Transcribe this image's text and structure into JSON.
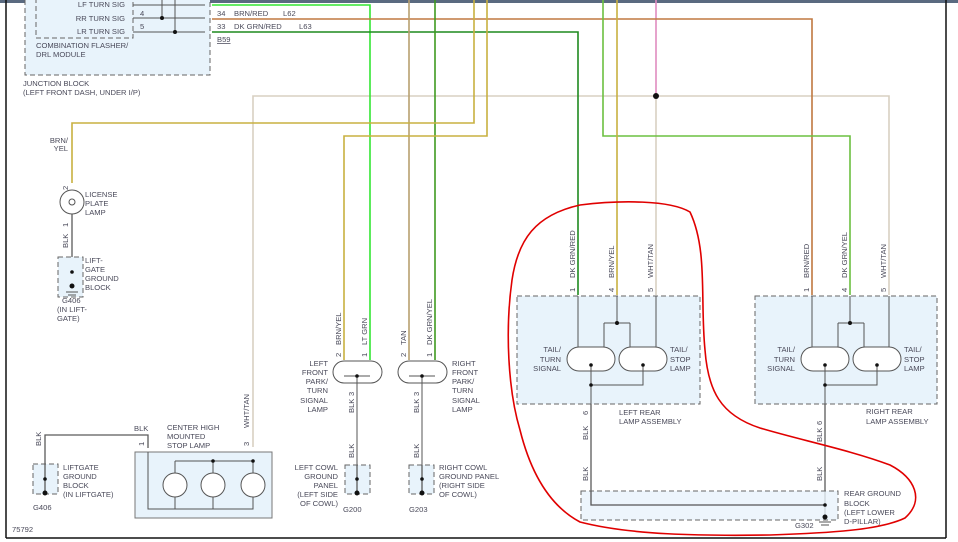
{
  "diagram_id": "75792",
  "colors": {
    "brn_red": "#c07840",
    "dk_grn_red": "#1f8a1f",
    "lt_grn": "#33e633",
    "tan": "#b8a070",
    "dk_grn_yel": "#3f9a20",
    "brn_yel": "#c8b040",
    "wht_tan": "#d8d0c2",
    "pink": "#e08cc0",
    "blk": "#5a5a5a",
    "annotation": "#e00000"
  },
  "junction_block": {
    "module_signals": [
      "LF TURN SIG",
      "RR TURN SIG",
      "LR TURN SIG"
    ],
    "module_pins": [
      "4",
      "5"
    ],
    "module_name": [
      "COMBINATION FLASHER/",
      "DRL MODULE"
    ],
    "name": [
      "JUNCTION BLOCK",
      "(LEFT FRONT DASH, UNDER I/P)"
    ],
    "connector_rows": [
      {
        "pin": "34",
        "color": "BRN/RED",
        "circuit": "L62"
      },
      {
        "pin": "33",
        "color": "DK GRN/RED",
        "circuit": "L63"
      }
    ],
    "connector": "B59"
  },
  "license_lamp": {
    "wire_color": [
      "BRN/",
      "YEL"
    ],
    "pin_top": "2",
    "pin_bottom": "1",
    "name": [
      "LICENSE",
      "PLATE",
      "LAMP"
    ],
    "ground_wire": "BLK",
    "ground_block": [
      "LIFT-",
      "GATE",
      "GROUND",
      "BLOCK"
    ],
    "ground_id": [
      "G406",
      "(IN LIFT-",
      "GATE)"
    ]
  },
  "chmsl": {
    "name": [
      "CENTER HIGH",
      "MOUNTED",
      "STOP LAMP"
    ],
    "wire_in": "WHT/TAN",
    "pin_in": "3",
    "pin_gnd": "1",
    "gnd_wire_top": "BLK",
    "gnd_wire_side": "BLK",
    "ground_block": [
      "LIFTGATE",
      "GROUND",
      "BLOCK",
      "(IN LIFTGATE)"
    ],
    "ground_id": "G406"
  },
  "left_front": {
    "wires": [
      {
        "pin": "2",
        "color": "BRN/YEL"
      },
      {
        "pin": "1",
        "color": "LT GRN"
      }
    ],
    "name": [
      "LEFT",
      "FRONT",
      "PARK/",
      "TURN",
      "SIGNAL",
      "LAMP"
    ],
    "gnd_pin": "3",
    "gnd_wire": "BLK",
    "gnd_wire2": "BLK",
    "ground_block": [
      "LEFT COWL",
      "GROUND",
      "PANEL",
      "(LEFT SIDE",
      "OF COWL)"
    ],
    "ground_id": "G200"
  },
  "right_front": {
    "wires": [
      {
        "pin": "2",
        "color": "TAN"
      },
      {
        "pin": "1",
        "color": "DK GRN/YEL"
      }
    ],
    "name": [
      "RIGHT",
      "FRONT",
      "PARK/",
      "TURN",
      "SIGNAL",
      "LAMP"
    ],
    "gnd_pin": "3",
    "gnd_wire": "BLK",
    "gnd_wire2": "BLK",
    "ground_block": [
      "RIGHT COWL",
      "GROUND PANEL",
      "(RIGHT SIDE",
      "OF COWL)"
    ],
    "ground_id": "G203"
  },
  "left_rear": {
    "wires": [
      {
        "pin": "1",
        "color": "DK GRN/RED"
      },
      {
        "pin": "4",
        "color": "BRN/YEL"
      },
      {
        "pin": "5",
        "color": "WHT/TAN"
      }
    ],
    "lamp_left": [
      "TAIL/",
      "TURN",
      "SIGNAL"
    ],
    "lamp_right": [
      "TAIL/",
      "STOP",
      "LAMP"
    ],
    "name": [
      "LEFT REAR",
      "LAMP ASSEMBLY"
    ],
    "gnd_pin": "6",
    "gnd_wire": "BLK",
    "gnd_wire2": "BLK"
  },
  "right_rear": {
    "wires": [
      {
        "pin": "1",
        "color": "BRN/RED"
      },
      {
        "pin": "4",
        "color": "DK GRN/YEL"
      },
      {
        "pin": "5",
        "color": "WHT/TAN"
      }
    ],
    "lamp_left": [
      "TAIL/",
      "TURN",
      "SIGNAL"
    ],
    "lamp_right": [
      "TAIL/",
      "STOP",
      "LAMP"
    ],
    "name": [
      "RIGHT REAR",
      "LAMP ASSEMBLY"
    ],
    "gnd_pin": "6",
    "gnd_wire": "BLK",
    "gnd_wire2": "BLK"
  },
  "rear_ground": {
    "name": [
      "REAR GROUND",
      "BLOCK",
      "(LEFT LOWER",
      "D-PILLAR)"
    ],
    "ground_id": "G302"
  }
}
